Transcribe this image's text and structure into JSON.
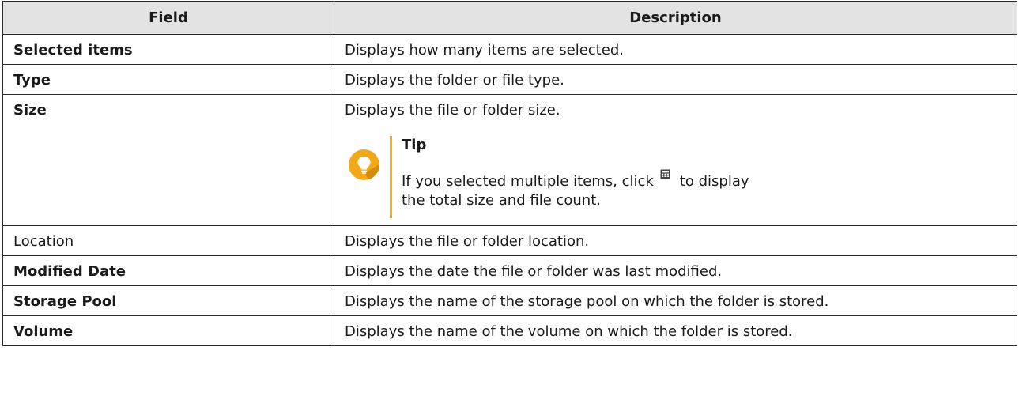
{
  "table": {
    "headers": {
      "field": "Field",
      "description": "Description"
    },
    "rows": [
      {
        "field": "Selected items",
        "description": "Displays how many items are selected."
      },
      {
        "field": "Type",
        "description": "Displays the folder or file type."
      },
      {
        "field": "Size",
        "description": "Displays the file or folder size.",
        "tip": {
          "icon": "lightbulb-icon",
          "title": "Tip",
          "text_before_icon": "If you selected multiple items, click",
          "inline_icon": "calculator-icon",
          "text_after_icon": "to display the total size and file count."
        }
      },
      {
        "field": "Location",
        "description": "Displays the file or folder location."
      },
      {
        "field": "Modified Date",
        "description": "Displays the date the file or folder was last modified."
      },
      {
        "field": "Storage Pool",
        "description": "Displays the name of the storage pool on which the folder is stored."
      },
      {
        "field": "Volume",
        "description": "Displays the name of the volume on which the folder is stored."
      }
    ]
  },
  "colors": {
    "header_bg": "#e3e3e3",
    "border": "#2b2b2b",
    "tip_accent": "#f1a91c"
  }
}
